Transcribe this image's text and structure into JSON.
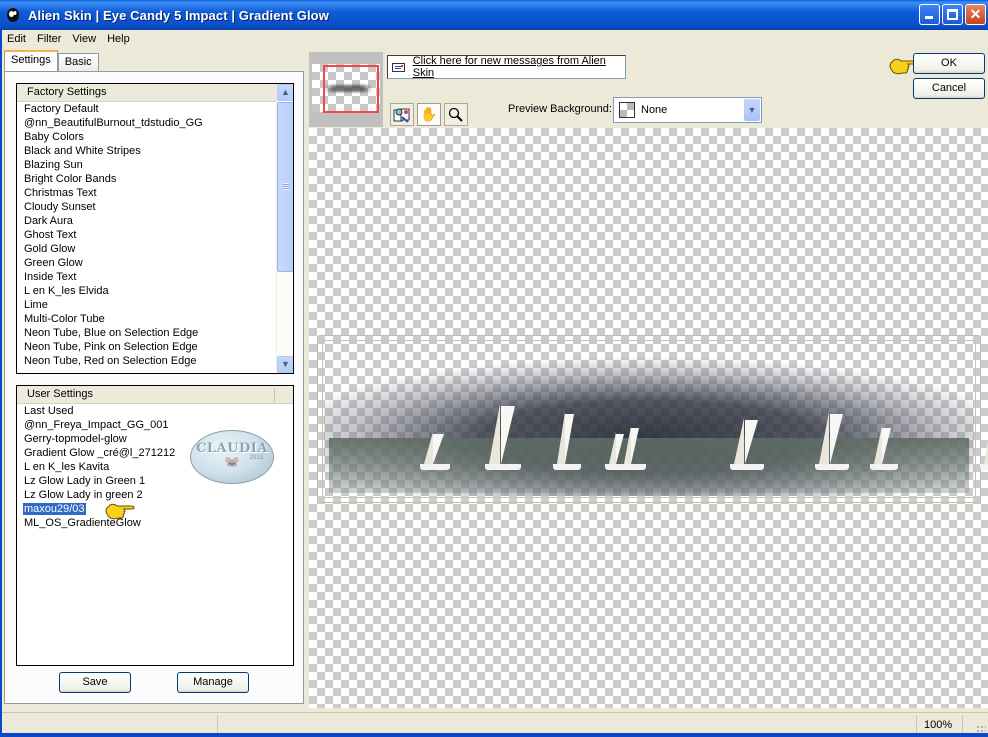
{
  "window": {
    "title": "Alien Skin  |  Eye Candy 5 Impact  |  Gradient Glow",
    "controls": [
      "minimize",
      "maximize",
      "close"
    ]
  },
  "menu": [
    "Edit",
    "Filter",
    "View",
    "Help"
  ],
  "tabs": [
    {
      "label": "Settings",
      "active": true
    },
    {
      "label": "Basic",
      "active": false
    }
  ],
  "factory_settings": {
    "header": "Factory Settings",
    "items": [
      "Factory Default",
      "@nn_BeautifulBurnout_tdstudio_GG",
      "Baby Colors",
      "Black and White Stripes",
      "Blazing Sun",
      "Bright Color Bands",
      "Christmas Text",
      "Cloudy Sunset",
      "Dark Aura",
      "Ghost Text",
      "Gold Glow",
      "Green Glow",
      "Inside Text",
      "L en K_les Elvida",
      "Lime",
      "Multi-Color Tube",
      "Neon Tube, Blue on Selection Edge",
      "Neon Tube, Pink on Selection Edge",
      "Neon Tube, Red on Selection Edge"
    ]
  },
  "user_settings": {
    "header": "User Settings",
    "items": [
      "Last Used",
      "@nn_Freya_Impact_GG_001",
      "Gerry-topmodel-glow",
      "Gradient Glow _cré@l_271212",
      "L en K_les Kavita",
      "Lz Glow Lady in Green 1",
      "Lz Glow Lady in green 2",
      "maxou29/03",
      "ML_OS_GradienteGlow"
    ],
    "selected": "maxou29/03",
    "watermark_text": "CLAUDIA",
    "watermark_year": "2013"
  },
  "buttons": {
    "save": "Save",
    "manage": "Manage",
    "ok": "OK",
    "cancel": "Cancel"
  },
  "messages_link": "Click here for new messages from Alien Skin",
  "toolbar": {
    "tools": [
      "preview-compare-tool",
      "hand-tool",
      "zoom-tool"
    ],
    "active_tool": "hand-tool"
  },
  "preview_background": {
    "label": "Preview Background:",
    "value": "None"
  },
  "status": {
    "zoom": "100%"
  },
  "colors": {
    "titlebar": "#0a5fd8",
    "selection": "#316ac5",
    "nav_rect": "#f04848",
    "panel_bg": "#ece9d8"
  }
}
